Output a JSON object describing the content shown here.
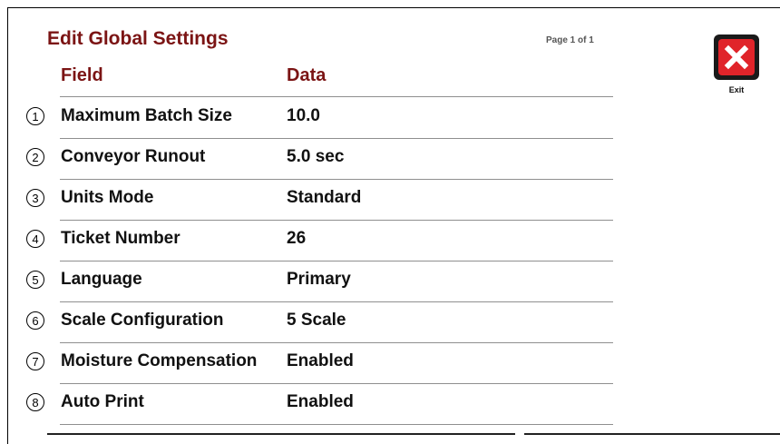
{
  "title": "Edit Global Settings",
  "page_indicator": "Page 1 of 1",
  "columns": {
    "field": "Field",
    "data": "Data"
  },
  "exit": {
    "label": "Exit",
    "icon": "close-x-icon",
    "colors": {
      "fill": "#e0242a",
      "border": "#1a1a1a"
    }
  },
  "accent_color": "#7b1414",
  "rows": [
    {
      "number": "1",
      "field": "Maximum Batch Size",
      "value": "10.0"
    },
    {
      "number": "2",
      "field": "Conveyor Runout",
      "value": "5.0 sec"
    },
    {
      "number": "3",
      "field": "Units Mode",
      "value": "Standard"
    },
    {
      "number": "4",
      "field": "Ticket Number",
      "value": "26"
    },
    {
      "number": "5",
      "field": "Language",
      "value": "Primary"
    },
    {
      "number": "6",
      "field": "Scale Configuration",
      "value": "5 Scale"
    },
    {
      "number": "7",
      "field": "Moisture Compensation",
      "value": "Enabled"
    },
    {
      "number": "8",
      "field": "Auto Print",
      "value": "Enabled"
    }
  ]
}
